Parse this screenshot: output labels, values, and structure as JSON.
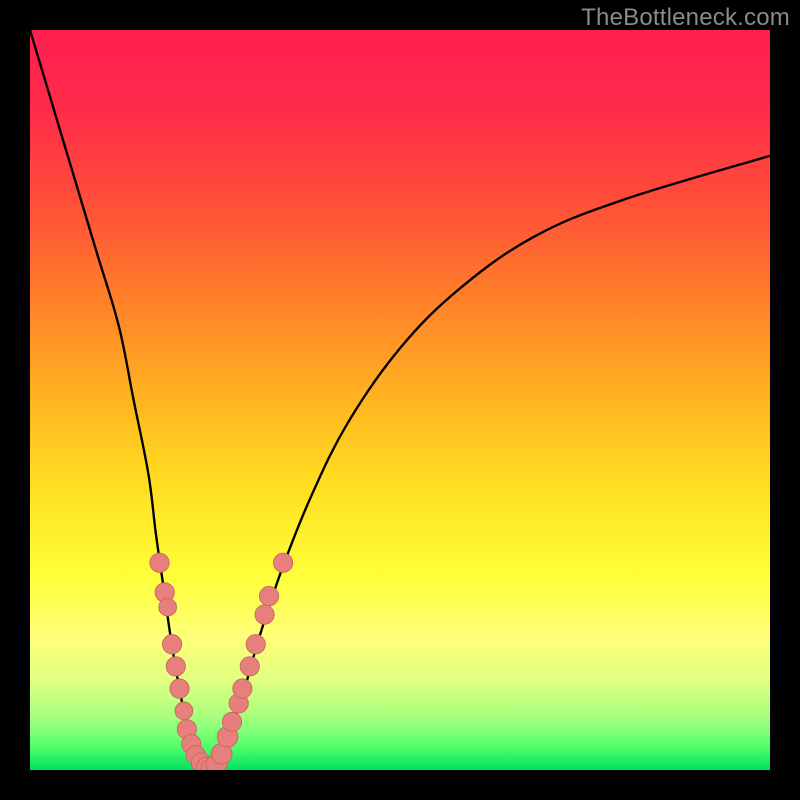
{
  "watermark": "TheBottleneck.com",
  "colors": {
    "gradient_stops": [
      {
        "offset": 0.0,
        "color": "#ff1f4f"
      },
      {
        "offset": 0.1,
        "color": "#ff2a4a"
      },
      {
        "offset": 0.22,
        "color": "#ff4a3a"
      },
      {
        "offset": 0.35,
        "color": "#ff7a2a"
      },
      {
        "offset": 0.5,
        "color": "#ffb41f"
      },
      {
        "offset": 0.62,
        "color": "#ffe020"
      },
      {
        "offset": 0.74,
        "color": "#feff3a"
      },
      {
        "offset": 0.82,
        "color": "#ffff7a"
      },
      {
        "offset": 0.88,
        "color": "#e0ff80"
      },
      {
        "offset": 0.93,
        "color": "#a6ff7e"
      },
      {
        "offset": 0.97,
        "color": "#4eff6a"
      },
      {
        "offset": 1.0,
        "color": "#00e060"
      }
    ],
    "curve": "#000000",
    "dot_fill": "#e77f7d",
    "dot_stroke": "#c96560"
  },
  "chart_data": {
    "type": "line",
    "title": "",
    "xlabel": "",
    "ylabel": "",
    "xlim": [
      0,
      100
    ],
    "ylim": [
      0,
      100
    ],
    "left_curve": [
      {
        "x": 0,
        "y": 100
      },
      {
        "x": 3,
        "y": 90
      },
      {
        "x": 6,
        "y": 80
      },
      {
        "x": 9,
        "y": 70
      },
      {
        "x": 12,
        "y": 60
      },
      {
        "x": 14,
        "y": 50
      },
      {
        "x": 16,
        "y": 40
      },
      {
        "x": 17,
        "y": 32
      },
      {
        "x": 18,
        "y": 25
      },
      {
        "x": 19,
        "y": 18
      },
      {
        "x": 20,
        "y": 12
      },
      {
        "x": 21,
        "y": 7
      },
      {
        "x": 22,
        "y": 3
      },
      {
        "x": 23,
        "y": 1
      },
      {
        "x": 24,
        "y": 0
      }
    ],
    "right_curve": [
      {
        "x": 24,
        "y": 0
      },
      {
        "x": 25,
        "y": 1
      },
      {
        "x": 27,
        "y": 5
      },
      {
        "x": 29,
        "y": 11
      },
      {
        "x": 31,
        "y": 18
      },
      {
        "x": 34,
        "y": 27
      },
      {
        "x": 38,
        "y": 37
      },
      {
        "x": 43,
        "y": 47
      },
      {
        "x": 50,
        "y": 57
      },
      {
        "x": 58,
        "y": 65
      },
      {
        "x": 68,
        "y": 72
      },
      {
        "x": 80,
        "y": 77
      },
      {
        "x": 100,
        "y": 83
      }
    ],
    "dots": [
      {
        "x": 17.5,
        "y": 28,
        "r": 1.3
      },
      {
        "x": 18.2,
        "y": 24,
        "r": 1.3
      },
      {
        "x": 18.6,
        "y": 22,
        "r": 1.2
      },
      {
        "x": 19.2,
        "y": 17,
        "r": 1.3
      },
      {
        "x": 19.7,
        "y": 14,
        "r": 1.3
      },
      {
        "x": 20.2,
        "y": 11,
        "r": 1.3
      },
      {
        "x": 20.8,
        "y": 8,
        "r": 1.2
      },
      {
        "x": 21.2,
        "y": 5.5,
        "r": 1.3
      },
      {
        "x": 21.8,
        "y": 3.5,
        "r": 1.3
      },
      {
        "x": 22.4,
        "y": 2,
        "r": 1.3
      },
      {
        "x": 23.1,
        "y": 1,
        "r": 1.3
      },
      {
        "x": 23.8,
        "y": 0.4,
        "r": 1.3
      },
      {
        "x": 24.4,
        "y": 0.2,
        "r": 1.3
      },
      {
        "x": 25.2,
        "y": 0.8,
        "r": 1.4
      },
      {
        "x": 25.9,
        "y": 2.2,
        "r": 1.4
      },
      {
        "x": 26.7,
        "y": 4.5,
        "r": 1.4
      },
      {
        "x": 27.3,
        "y": 6.5,
        "r": 1.3
      },
      {
        "x": 28.2,
        "y": 9,
        "r": 1.3
      },
      {
        "x": 28.7,
        "y": 11,
        "r": 1.3
      },
      {
        "x": 29.7,
        "y": 14,
        "r": 1.3
      },
      {
        "x": 30.5,
        "y": 17,
        "r": 1.3
      },
      {
        "x": 31.7,
        "y": 21,
        "r": 1.3
      },
      {
        "x": 32.3,
        "y": 23.5,
        "r": 1.3
      },
      {
        "x": 34.2,
        "y": 28,
        "r": 1.3
      }
    ]
  }
}
